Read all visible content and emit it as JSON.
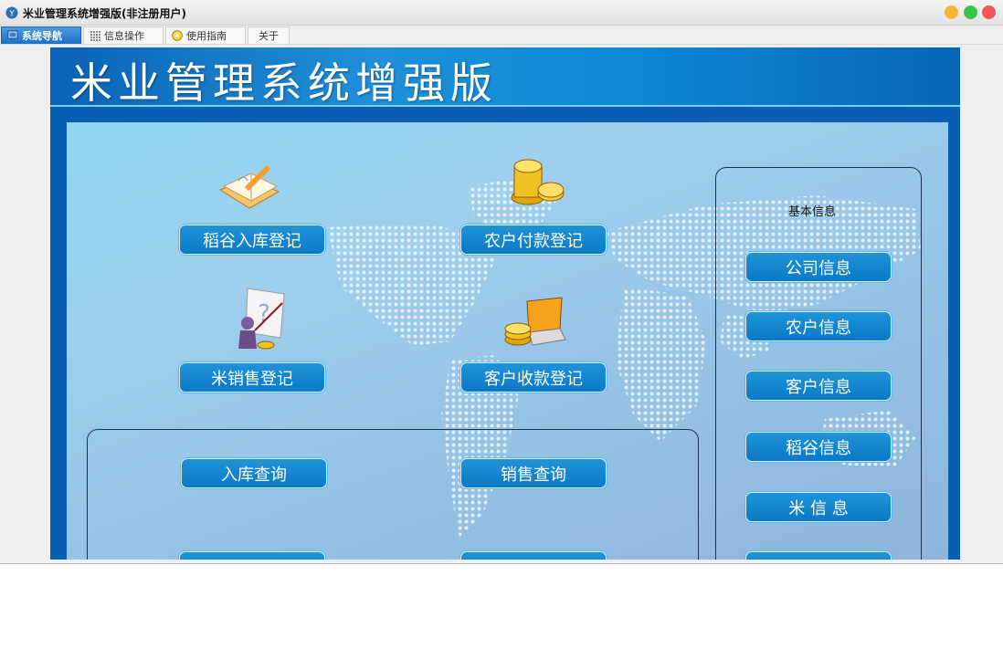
{
  "window": {
    "title": "米业管理系统增强版(非注册用户)",
    "controls": {
      "min_color": "#f5b637",
      "max_color": "#3cc149",
      "close_color": "#f05656"
    }
  },
  "tabs": [
    {
      "label": "系统导航",
      "icon": "monitor-icon",
      "active": true
    },
    {
      "label": "信息操作",
      "icon": "grid-icon",
      "active": false
    },
    {
      "label": "使用指南",
      "icon": "compass-icon",
      "active": false
    },
    {
      "label": "关于",
      "icon": "",
      "active": false
    }
  ],
  "banner": {
    "title": "米业管理系统增强版"
  },
  "main_buttons": {
    "grain_in": "稻谷入库登记",
    "farmer_pay": "农户付款登记",
    "rice_sale": "米销售登记",
    "customer_collect": "客户收款登记"
  },
  "query_buttons": {
    "in_query": "入库查询",
    "sale_query": "销售查询"
  },
  "basic_info": {
    "title": "基本信息",
    "items": [
      "公司信息",
      "农户信息",
      "客户信息",
      "稻谷信息",
      "米 信 息"
    ]
  },
  "colors": {
    "accent": "#0b79c7",
    "banner": "#0a62b7",
    "panel": "#9ecfee"
  }
}
